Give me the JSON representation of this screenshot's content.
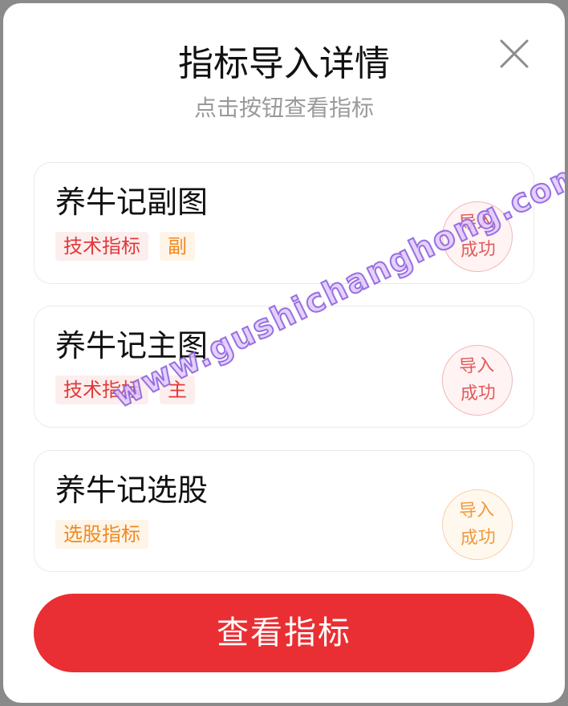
{
  "dialog": {
    "title": "指标导入详情",
    "subtitle": "点击按钮查看指标",
    "close_icon": "close-icon"
  },
  "items": [
    {
      "name": "养牛记副图",
      "tags": [
        {
          "label": "技术指标",
          "color": "red"
        },
        {
          "label": "副",
          "color": "orange"
        }
      ],
      "status": {
        "line1": "导入",
        "line2": "成功",
        "color": "red"
      }
    },
    {
      "name": "养牛记主图",
      "tags": [
        {
          "label": "技术指标",
          "color": "red"
        },
        {
          "label": "主",
          "color": "red"
        }
      ],
      "status": {
        "line1": "导入",
        "line2": "成功",
        "color": "red"
      }
    },
    {
      "name": "养牛记选股",
      "tags": [
        {
          "label": "选股指标",
          "color": "orange"
        }
      ],
      "status": {
        "line1": "导入",
        "line2": "成功",
        "color": "orange"
      }
    }
  ],
  "view_button": {
    "label": "查看指标"
  },
  "watermark": "www.gushichanghong.com",
  "colors": {
    "primary_red": "#e92f33",
    "tag_red": "#e03a3a",
    "tag_orange": "#ef8a1e"
  }
}
